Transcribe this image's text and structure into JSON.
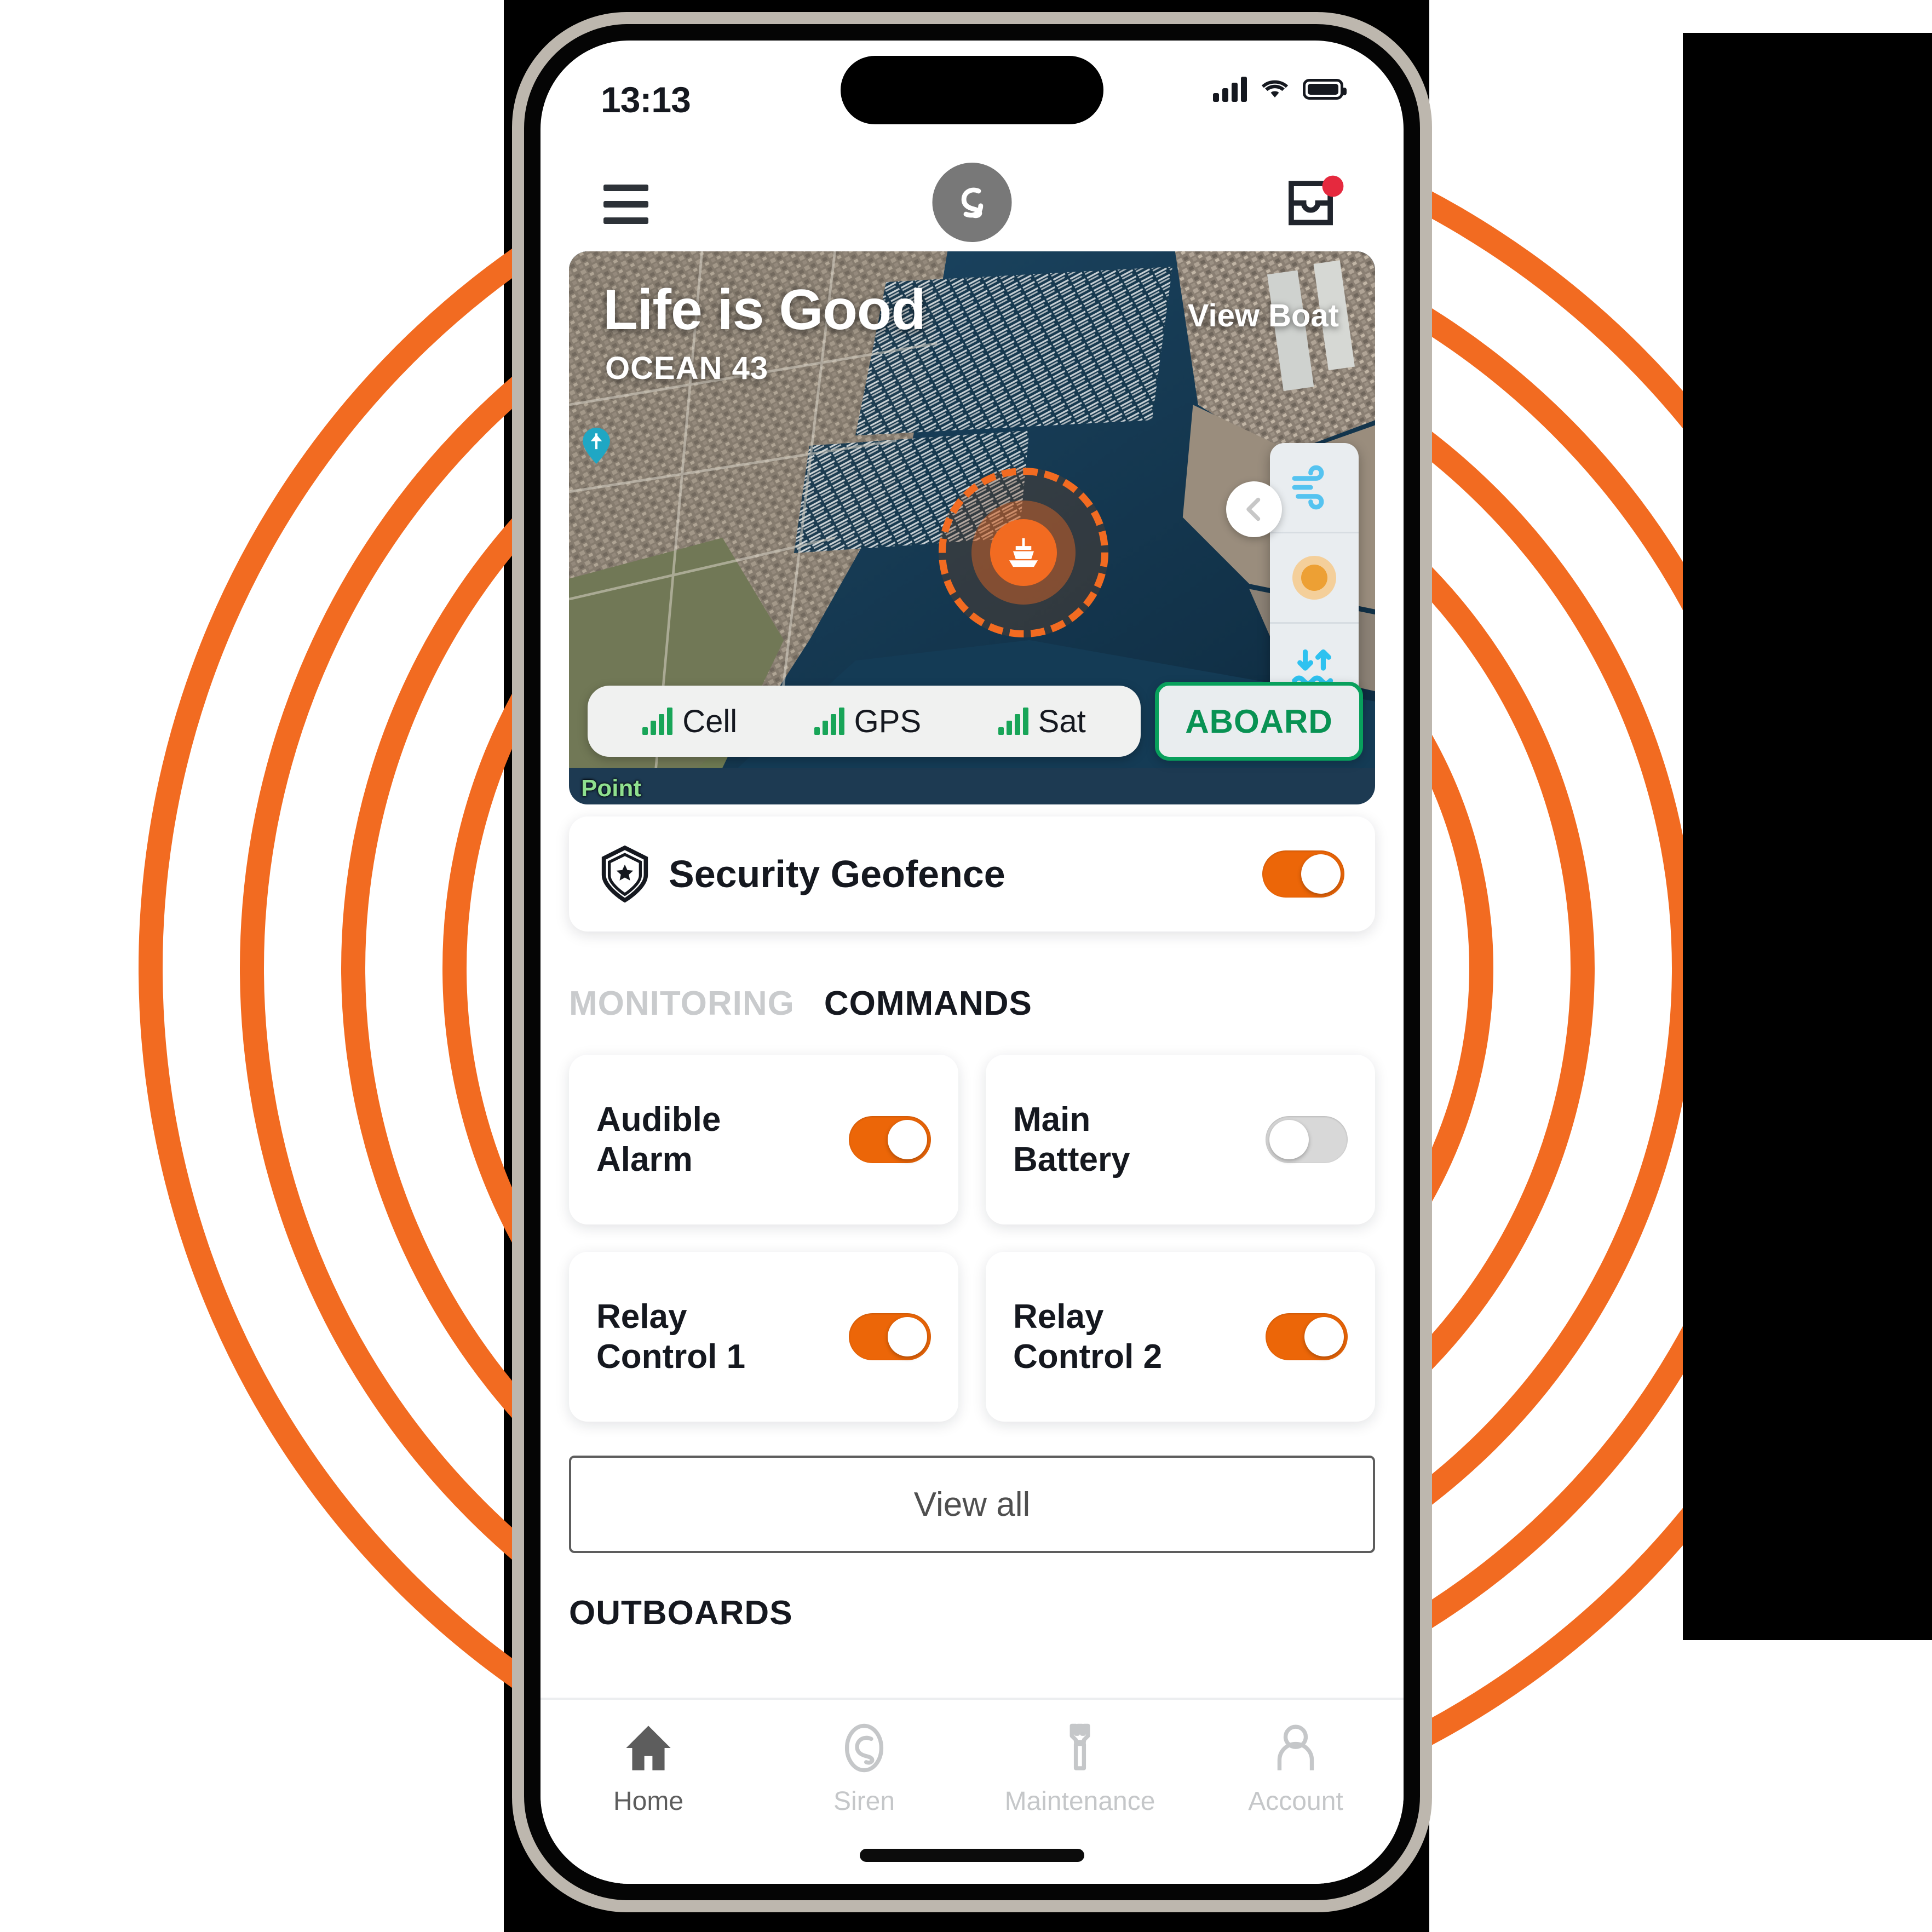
{
  "status_bar": {
    "time": "13:13",
    "cellular_icon": "signal-bars-icon",
    "wifi_icon": "wifi-icon",
    "battery_icon": "battery-icon"
  },
  "app_header": {
    "menu_icon": "hamburger-menu-icon",
    "logo_icon": "siren-marine-logo-icon",
    "inbox_icon": "inbox-icon",
    "notification_badge": true
  },
  "map_card": {
    "boat_name": "Life is Good",
    "boat_model": "OCEAN 43",
    "view_boat_label": "View Boat",
    "map_place_label": "Point",
    "layer_controls": [
      {
        "name": "wind-layer-button",
        "icon": "wind-icon"
      },
      {
        "name": "sun-layer-button",
        "icon": "sun-icon"
      },
      {
        "name": "tide-layer-button",
        "icon": "tide-icon"
      }
    ],
    "collapse_icon": "chevron-left-icon",
    "boat_marker_icon": "boat-icon",
    "geofence_circle": true,
    "signals": [
      {
        "label": "Cell",
        "icon": "signal-bars-icon",
        "strength": 4
      },
      {
        "label": "GPS",
        "icon": "signal-bars-icon",
        "strength": 4
      },
      {
        "label": "Sat",
        "icon": "signal-bars-icon",
        "strength": 4
      }
    ],
    "aboard_label": "ABOARD"
  },
  "geofence_row": {
    "icon": "shield-star-icon",
    "label": "Security Geofence",
    "toggle_state": "on"
  },
  "tabs": [
    {
      "label": "MONITORING",
      "active": false
    },
    {
      "label": "COMMANDS",
      "active": true
    }
  ],
  "commands": [
    {
      "label": "Audible Alarm",
      "toggle_state": "on"
    },
    {
      "label": "Main Battery",
      "toggle_state": "off"
    },
    {
      "label": "Relay Control 1",
      "toggle_state": "on"
    },
    {
      "label": "Relay Control 2",
      "toggle_state": "on"
    }
  ],
  "view_all_label": "View all",
  "next_section_label": "OUTBOARDS",
  "bottom_nav": [
    {
      "label": "Home",
      "icon": "home-icon",
      "active": true
    },
    {
      "label": "Siren",
      "icon": "siren-logo-icon",
      "active": false
    },
    {
      "label": "Maintenance",
      "icon": "wrench-icon",
      "active": false
    },
    {
      "label": "Account",
      "icon": "person-icon",
      "active": false
    }
  ],
  "colors": {
    "accent_orange": "#ec6608",
    "arc_orange": "#f26b21",
    "green": "#08a05c",
    "toggle_off_grey": "#d8d8d8",
    "text_dark": "#15181f",
    "badge_red": "#e5293e"
  }
}
